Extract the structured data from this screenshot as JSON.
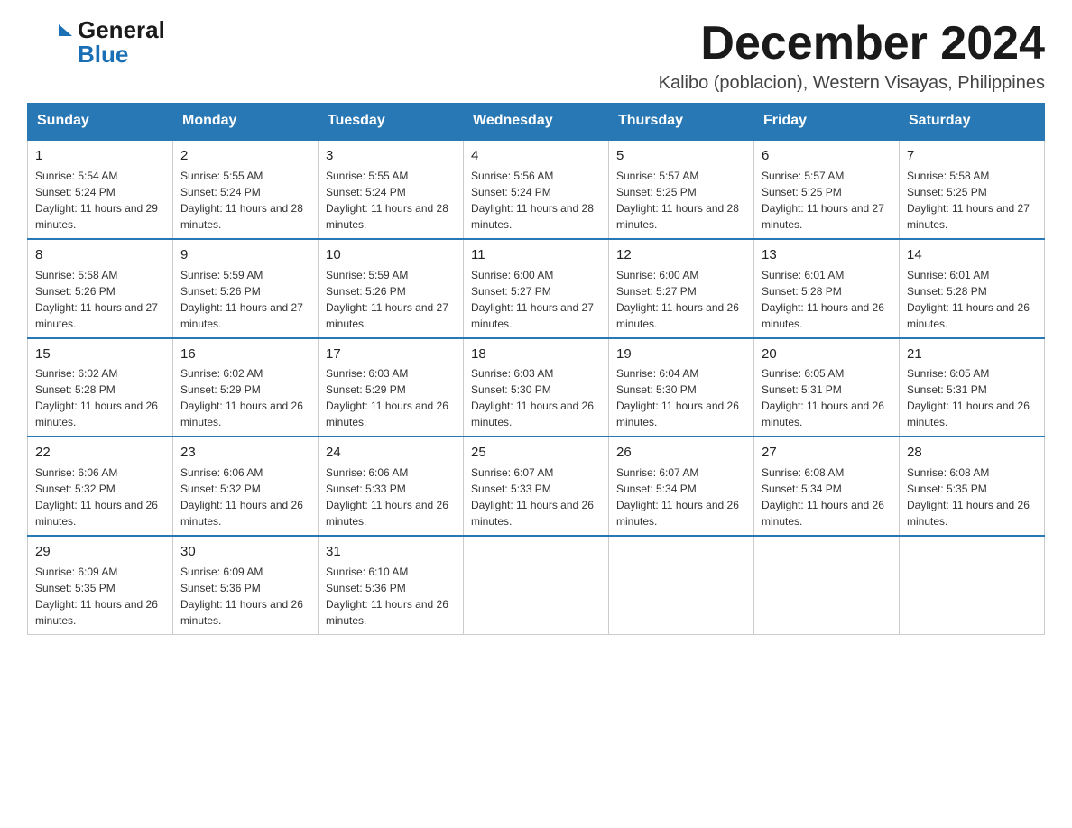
{
  "header": {
    "logo_general": "General",
    "logo_blue": "Blue",
    "month_year": "December 2024",
    "location": "Kalibo (poblacion), Western Visayas, Philippines"
  },
  "days_of_week": [
    "Sunday",
    "Monday",
    "Tuesday",
    "Wednesday",
    "Thursday",
    "Friday",
    "Saturday"
  ],
  "weeks": [
    [
      {
        "date": "1",
        "sunrise": "5:54 AM",
        "sunset": "5:24 PM",
        "daylight": "11 hours and 29 minutes."
      },
      {
        "date": "2",
        "sunrise": "5:55 AM",
        "sunset": "5:24 PM",
        "daylight": "11 hours and 28 minutes."
      },
      {
        "date": "3",
        "sunrise": "5:55 AM",
        "sunset": "5:24 PM",
        "daylight": "11 hours and 28 minutes."
      },
      {
        "date": "4",
        "sunrise": "5:56 AM",
        "sunset": "5:24 PM",
        "daylight": "11 hours and 28 minutes."
      },
      {
        "date": "5",
        "sunrise": "5:57 AM",
        "sunset": "5:25 PM",
        "daylight": "11 hours and 28 minutes."
      },
      {
        "date": "6",
        "sunrise": "5:57 AM",
        "sunset": "5:25 PM",
        "daylight": "11 hours and 27 minutes."
      },
      {
        "date": "7",
        "sunrise": "5:58 AM",
        "sunset": "5:25 PM",
        "daylight": "11 hours and 27 minutes."
      }
    ],
    [
      {
        "date": "8",
        "sunrise": "5:58 AM",
        "sunset": "5:26 PM",
        "daylight": "11 hours and 27 minutes."
      },
      {
        "date": "9",
        "sunrise": "5:59 AM",
        "sunset": "5:26 PM",
        "daylight": "11 hours and 27 minutes."
      },
      {
        "date": "10",
        "sunrise": "5:59 AM",
        "sunset": "5:26 PM",
        "daylight": "11 hours and 27 minutes."
      },
      {
        "date": "11",
        "sunrise": "6:00 AM",
        "sunset": "5:27 PM",
        "daylight": "11 hours and 27 minutes."
      },
      {
        "date": "12",
        "sunrise": "6:00 AM",
        "sunset": "5:27 PM",
        "daylight": "11 hours and 26 minutes."
      },
      {
        "date": "13",
        "sunrise": "6:01 AM",
        "sunset": "5:28 PM",
        "daylight": "11 hours and 26 minutes."
      },
      {
        "date": "14",
        "sunrise": "6:01 AM",
        "sunset": "5:28 PM",
        "daylight": "11 hours and 26 minutes."
      }
    ],
    [
      {
        "date": "15",
        "sunrise": "6:02 AM",
        "sunset": "5:28 PM",
        "daylight": "11 hours and 26 minutes."
      },
      {
        "date": "16",
        "sunrise": "6:02 AM",
        "sunset": "5:29 PM",
        "daylight": "11 hours and 26 minutes."
      },
      {
        "date": "17",
        "sunrise": "6:03 AM",
        "sunset": "5:29 PM",
        "daylight": "11 hours and 26 minutes."
      },
      {
        "date": "18",
        "sunrise": "6:03 AM",
        "sunset": "5:30 PM",
        "daylight": "11 hours and 26 minutes."
      },
      {
        "date": "19",
        "sunrise": "6:04 AM",
        "sunset": "5:30 PM",
        "daylight": "11 hours and 26 minutes."
      },
      {
        "date": "20",
        "sunrise": "6:05 AM",
        "sunset": "5:31 PM",
        "daylight": "11 hours and 26 minutes."
      },
      {
        "date": "21",
        "sunrise": "6:05 AM",
        "sunset": "5:31 PM",
        "daylight": "11 hours and 26 minutes."
      }
    ],
    [
      {
        "date": "22",
        "sunrise": "6:06 AM",
        "sunset": "5:32 PM",
        "daylight": "11 hours and 26 minutes."
      },
      {
        "date": "23",
        "sunrise": "6:06 AM",
        "sunset": "5:32 PM",
        "daylight": "11 hours and 26 minutes."
      },
      {
        "date": "24",
        "sunrise": "6:06 AM",
        "sunset": "5:33 PM",
        "daylight": "11 hours and 26 minutes."
      },
      {
        "date": "25",
        "sunrise": "6:07 AM",
        "sunset": "5:33 PM",
        "daylight": "11 hours and 26 minutes."
      },
      {
        "date": "26",
        "sunrise": "6:07 AM",
        "sunset": "5:34 PM",
        "daylight": "11 hours and 26 minutes."
      },
      {
        "date": "27",
        "sunrise": "6:08 AM",
        "sunset": "5:34 PM",
        "daylight": "11 hours and 26 minutes."
      },
      {
        "date": "28",
        "sunrise": "6:08 AM",
        "sunset": "5:35 PM",
        "daylight": "11 hours and 26 minutes."
      }
    ],
    [
      {
        "date": "29",
        "sunrise": "6:09 AM",
        "sunset": "5:35 PM",
        "daylight": "11 hours and 26 minutes."
      },
      {
        "date": "30",
        "sunrise": "6:09 AM",
        "sunset": "5:36 PM",
        "daylight": "11 hours and 26 minutes."
      },
      {
        "date": "31",
        "sunrise": "6:10 AM",
        "sunset": "5:36 PM",
        "daylight": "11 hours and 26 minutes."
      },
      null,
      null,
      null,
      null
    ]
  ],
  "labels": {
    "sunrise_prefix": "Sunrise: ",
    "sunset_prefix": "Sunset: ",
    "daylight_prefix": "Daylight: "
  }
}
